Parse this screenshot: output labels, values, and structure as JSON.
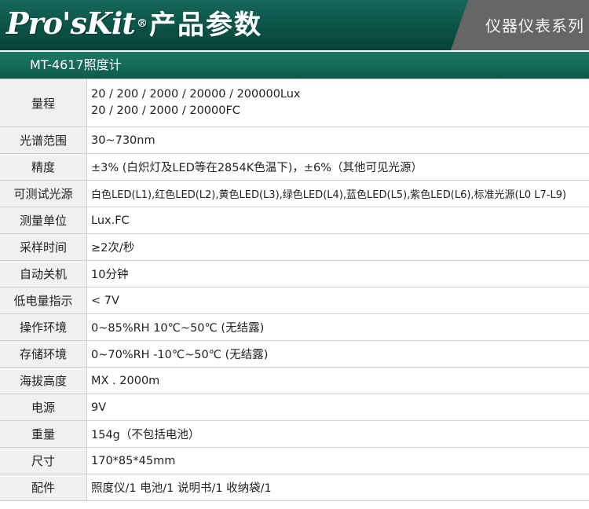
{
  "header": {
    "logo_text": "Pro'sKit",
    "logo_reg": "®",
    "title": "产品参数",
    "series_label": "仪器仪表系列"
  },
  "model": "MT-4617照度计",
  "specs": [
    {
      "label": "量程",
      "values": [
        "20  /  200  /  2000  /  20000  /  200000Lux",
        "20  /  200  /  2000  /  20000FC"
      ]
    },
    {
      "label": "光谱范围",
      "values": [
        "30~730nm"
      ]
    },
    {
      "label": "精度",
      "values": [
        "±3% (白炽灯及LED等在2854K色温下)，±6%（其他可见光源）"
      ]
    },
    {
      "label": "可测试光源",
      "values": [
        "白色LED(L1),红色LED(L2),黄色LED(L3),绿色LED(L4),蓝色LED(L5),紫色LED(L6),标准光源(L0 L7-L9)"
      ]
    },
    {
      "label": "测量单位",
      "values": [
        "Lux.FC"
      ]
    },
    {
      "label": "采样时间",
      "values": [
        "≥2次/秒"
      ]
    },
    {
      "label": "自动关机",
      "values": [
        "10分钟"
      ]
    },
    {
      "label": "低电量指示",
      "values": [
        "< 7V"
      ]
    },
    {
      "label": "操作环境",
      "values": [
        "0~85%RH   10℃~50℃ (无结露)"
      ]
    },
    {
      "label": "存储环境",
      "values": [
        "0~70%RH   -10℃~50℃ (无结露)"
      ]
    },
    {
      "label": "海拔高度",
      "values": [
        "MX . 2000m"
      ]
    },
    {
      "label": "电源",
      "values": [
        "9V"
      ]
    },
    {
      "label": "重量",
      "values": [
        "154g（不包括电池）"
      ]
    },
    {
      "label": "尺寸",
      "values": [
        "170*85*45mm"
      ]
    },
    {
      "label": "配件",
      "values": [
        "照度仪/1  电池/1 说明书/1  收纳袋/1"
      ]
    }
  ]
}
